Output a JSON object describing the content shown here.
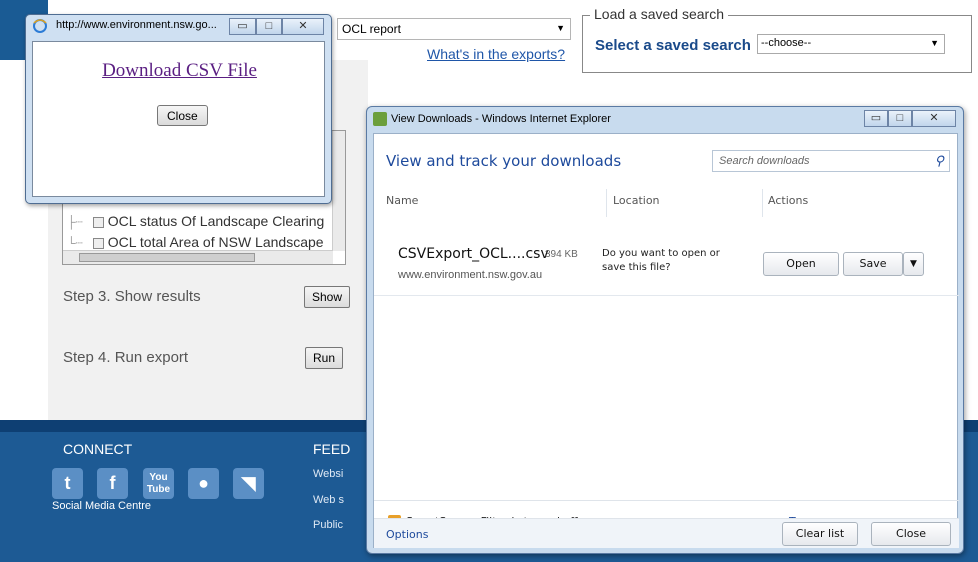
{
  "page": {
    "report_select": "OCL report",
    "exports_link": "What's in the exports?",
    "saved_search": {
      "legend": "Load a saved search",
      "label": "Select a saved search",
      "select_value": "--choose--"
    },
    "tree_items": [
      "OCL status Of Landscape Clearing",
      "OCL total Area of NSW Landscape"
    ],
    "step3_label": "Step 3. Show results",
    "step3_button": "Show",
    "step4_label": "Step 4. Run export",
    "step4_button": "Run",
    "footer": {
      "connect_heading": "CONNECT",
      "social_caption": "Social Media Centre",
      "feed_heading": "FEED",
      "feed_links": [
        "Websi",
        "Web s",
        "Public"
      ]
    }
  },
  "csv_popup": {
    "title": "http://www.environment.nsw.go...",
    "link_text": "Download CSV File",
    "close_button": "Close"
  },
  "downloads_window": {
    "title": "View Downloads - Windows Internet Explorer",
    "heading": "View and track your downloads",
    "search_placeholder": "Search downloads",
    "columns": [
      "Name",
      "Location",
      "Actions"
    ],
    "item": {
      "filename": "CSVExport_OCL....csv",
      "size": "394 KB",
      "source": "www.environment.nsw.gov.au",
      "question": "Do you want to open or save this file?",
      "open_button": "Open",
      "save_button": "Save"
    },
    "smartscreen_text": "SmartScreen Filter is turned off.",
    "turn_on_link": "Turn on",
    "options_link": "Options",
    "clear_list_button": "Clear list",
    "close_button": "Close"
  }
}
